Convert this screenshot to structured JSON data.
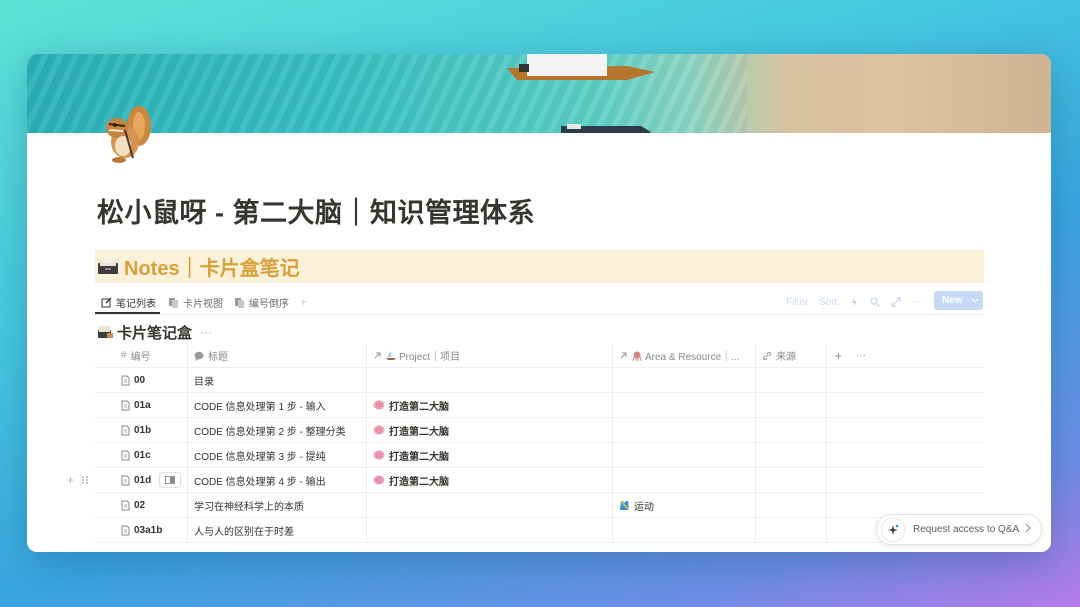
{
  "page": {
    "title": "松小鼠呀 - 第二大脑｜知识管理体系",
    "icon": "chipmunk-emoji"
  },
  "callout": {
    "icon": "card-file-box-icon",
    "text": "Notes｜卡片盒笔记"
  },
  "tabs": [
    {
      "label": "笔记列表",
      "icon": "edit-icon",
      "active": true
    },
    {
      "label": "卡片视图",
      "icon": "cards-icon",
      "active": false
    },
    {
      "label": "编号倒序",
      "icon": "cards-icon",
      "active": false
    }
  ],
  "toolbar": {
    "filter": "Filter",
    "sort": "Sort",
    "new": "New"
  },
  "database": {
    "title": "卡片笔记盒",
    "more": "···"
  },
  "columns": {
    "num": "编号",
    "title": "标题",
    "project": "Project｜项目",
    "area": "Area & Resource｜...",
    "source": "来源",
    "add": "+",
    "more": "···"
  },
  "rows": [
    {
      "num": "00",
      "title": "目录",
      "project": "",
      "area": ""
    },
    {
      "num": "01a",
      "title": "CODE 信息处理第 1 步 - 输入",
      "project": "打造第二大脑",
      "area": ""
    },
    {
      "num": "01b",
      "title": "CODE 信息处理第 2 步 - 整理分类",
      "project": "打造第二大脑",
      "area": ""
    },
    {
      "num": "01c",
      "title": "CODE 信息处理第 3 步 - 提纯",
      "project": "打造第二大脑",
      "area": ""
    },
    {
      "num": "01d",
      "title": "CODE 信息处理第 4 步 - 输出",
      "project": "打造第二大脑",
      "area": ""
    },
    {
      "num": "02",
      "title": "学习在神经科学上的本质",
      "project": "",
      "area": "运动"
    },
    {
      "num": "03a1b",
      "title": "人与人的区别在于时差",
      "project": "",
      "area": ""
    }
  ],
  "qa_button": {
    "label": "Request access to Q&A"
  },
  "colors": {
    "callout_bg": "#fbf0d8",
    "callout_text": "#d9a03a",
    "new_button": "#c6daf5"
  }
}
